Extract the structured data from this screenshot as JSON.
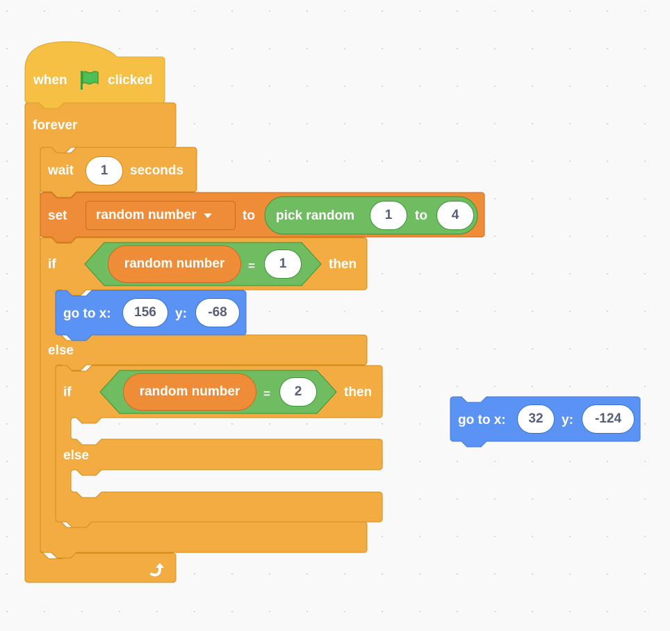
{
  "colors": {
    "events": "#f5c043",
    "control": "#f3ac41",
    "variables": "#ef8c38",
    "operators": "#70bc61",
    "motion": "#5b93f5",
    "workspace_bg": "#f9f9f9",
    "field_text": "#575e75"
  },
  "script_main": {
    "hat": {
      "label_when": "when",
      "icon": "green-flag-icon",
      "label_clicked": "clicked"
    },
    "forever": {
      "label": "forever",
      "end_icon": "loop-arrow-icon"
    },
    "wait": {
      "label_wait": "wait",
      "value": "1",
      "label_seconds": "seconds"
    },
    "set_var": {
      "label_set": "set",
      "variable": "random number",
      "label_to": "to",
      "pick_random": {
        "label": "pick random",
        "from": "1",
        "label_to": "to",
        "to": "4"
      }
    },
    "if_else_outer": {
      "label_if": "if",
      "condition": {
        "variable": "random number",
        "operator": "=",
        "value": "1"
      },
      "label_then": "then",
      "then_branch": {
        "go_to": {
          "label_x": "go to x:",
          "x": "156",
          "label_y": "y:",
          "y": "-68"
        }
      },
      "label_else": "else",
      "else_branch": {
        "if_else_inner": {
          "label_if": "if",
          "condition": {
            "variable": "random number",
            "operator": "=",
            "value": "2"
          },
          "label_then": "then",
          "label_else": "else"
        }
      }
    }
  },
  "script_loose": {
    "go_to": {
      "label_x": "go to x:",
      "x": "32",
      "label_y": "y:",
      "y": "-124"
    }
  }
}
